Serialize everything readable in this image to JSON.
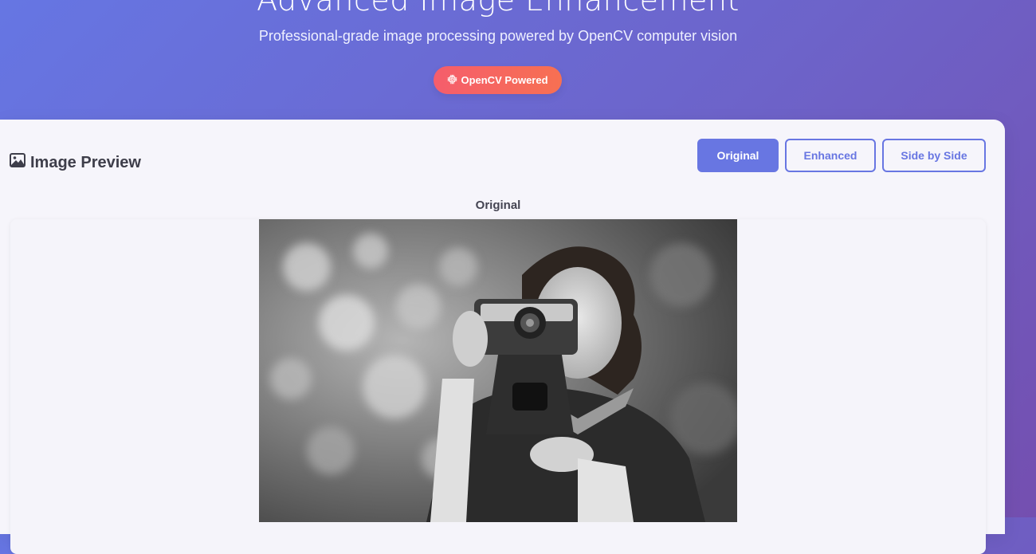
{
  "header": {
    "title": "Advanced Image Enhancement",
    "subtitle": "Professional-grade image processing powered by OpenCV computer vision",
    "badge_label": "OpenCV Powered",
    "badge_icon": "chip-icon"
  },
  "preview": {
    "title": "Image Preview",
    "title_icon": "image-icon",
    "view_buttons": [
      {
        "label": "Original",
        "active": true
      },
      {
        "label": "Enhanced",
        "active": false
      },
      {
        "label": "Side by Side",
        "active": false
      }
    ],
    "current_view_label": "Original",
    "image_alt": "Woman holding vintage camera (black and white photo)"
  },
  "colors": {
    "accent": "#6876e2",
    "badge_start": "#f55d6c",
    "badge_end": "#f77052",
    "card_bg": "#f6f5fb"
  }
}
